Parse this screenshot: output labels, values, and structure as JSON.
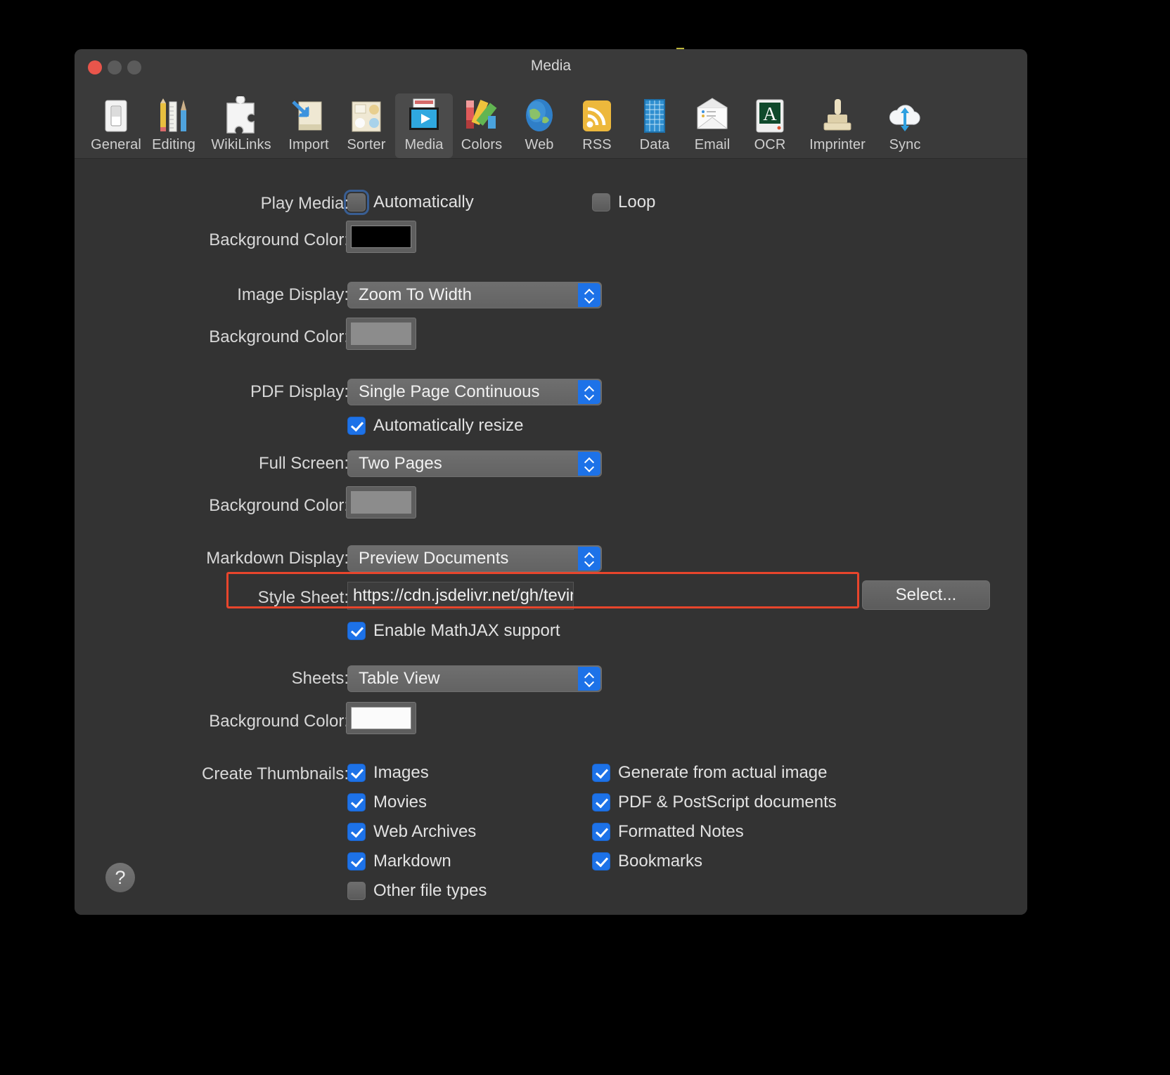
{
  "window": {
    "title": "Media"
  },
  "toolbar": {
    "items": [
      {
        "label": "General",
        "icon": "switch-icon"
      },
      {
        "label": "Editing",
        "icon": "pencil-ruler-brush-icon"
      },
      {
        "label": "WikiLinks",
        "icon": "puzzle-icon"
      },
      {
        "label": "Import",
        "icon": "import-arrow-icon"
      },
      {
        "label": "Sorter",
        "icon": "sorter-grid-icon"
      },
      {
        "label": "Media",
        "icon": "media-play-icon",
        "selected": true
      },
      {
        "label": "Colors",
        "icon": "color-swatches-icon"
      },
      {
        "label": "Web",
        "icon": "globe-icon"
      },
      {
        "label": "RSS",
        "icon": "rss-icon"
      },
      {
        "label": "Data",
        "icon": "spreadsheet-icon"
      },
      {
        "label": "Email",
        "icon": "envelope-icon"
      },
      {
        "label": "OCR",
        "icon": "ocr-letter-icon"
      },
      {
        "label": "Imprinter",
        "icon": "stamp-icon"
      },
      {
        "label": "Sync",
        "icon": "cloud-sync-icon"
      }
    ]
  },
  "form": {
    "play_media_label": "Play Media:",
    "play_media_automatically": "Automatically",
    "play_media_automatically_checked": false,
    "loop_label": "Loop",
    "loop_checked": false,
    "media_bg_label": "Background Color:",
    "media_bg_color": "#000000",
    "image_display_label": "Image Display:",
    "image_display_value": "Zoom To Width",
    "image_bg_label": "Background Color:",
    "image_bg_color": "#8c8c8c",
    "pdf_display_label": "PDF Display:",
    "pdf_display_value": "Single Page Continuous",
    "auto_resize_label": "Automatically resize",
    "auto_resize_checked": true,
    "full_screen_label": "Full Screen:",
    "full_screen_value": "Two Pages",
    "pdf_bg_label": "Background Color:",
    "pdf_bg_color": "#8c8c8c",
    "markdown_display_label": "Markdown Display:",
    "markdown_display_value": "Preview Documents",
    "style_sheet_label": "Style Sheet:",
    "style_sheet_value": "https://cdn.jsdelivr.net/gh/tevino/devonthink-markdown-css@",
    "select_button": "Select...",
    "mathjax_label": "Enable MathJAX support",
    "mathjax_checked": true,
    "sheets_label": "Sheets:",
    "sheets_value": "Table View",
    "sheets_bg_label": "Background Color:",
    "sheets_bg_color": "#fbfbfb",
    "create_thumbnails_label": "Create Thumbnails:",
    "thumbnails_left": [
      {
        "label": "Images",
        "checked": true
      },
      {
        "label": "Movies",
        "checked": true
      },
      {
        "label": "Web Archives",
        "checked": true
      },
      {
        "label": "Markdown",
        "checked": true
      },
      {
        "label": "Other file types",
        "checked": false
      }
    ],
    "thumbnails_right": [
      {
        "label": "Generate from actual image",
        "checked": true
      },
      {
        "label": "PDF & PostScript documents",
        "checked": true
      },
      {
        "label": "Formatted Notes",
        "checked": true
      },
      {
        "label": "Bookmarks",
        "checked": true
      }
    ],
    "help_button": "?"
  },
  "accent": "#1d72e8",
  "highlight_color": "#e8452c"
}
